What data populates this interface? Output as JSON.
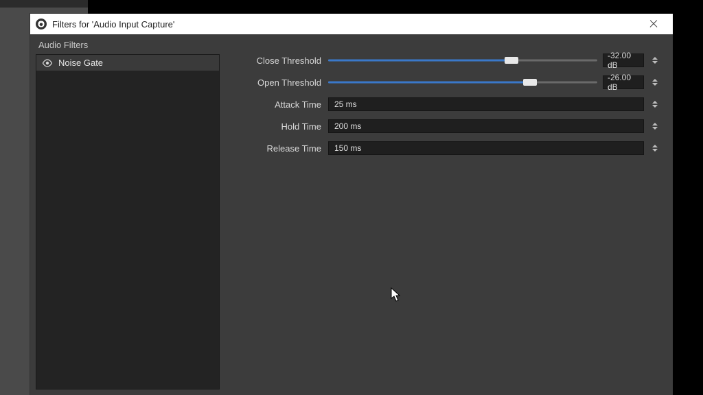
{
  "titlebar": {
    "title": "Filters for 'Audio Input Capture'"
  },
  "sidebar": {
    "header": "Audio Filters",
    "items": [
      {
        "label": "Noise Gate",
        "visible": true
      }
    ]
  },
  "settings": {
    "close_threshold": {
      "label": "Close Threshold",
      "value_text": "-32.00 dB",
      "fill_pct": 68
    },
    "open_threshold": {
      "label": "Open Threshold",
      "value_text": "-26.00 dB",
      "fill_pct": 75
    },
    "attack_time": {
      "label": "Attack Time",
      "value_text": "25 ms"
    },
    "hold_time": {
      "label": "Hold Time",
      "value_text": "200 ms"
    },
    "release_time": {
      "label": "Release Time",
      "value_text": "150 ms"
    }
  },
  "colors": {
    "accent": "#3a78c9",
    "panel": "#3c3c3c",
    "input_bg": "#1f1f1f"
  }
}
